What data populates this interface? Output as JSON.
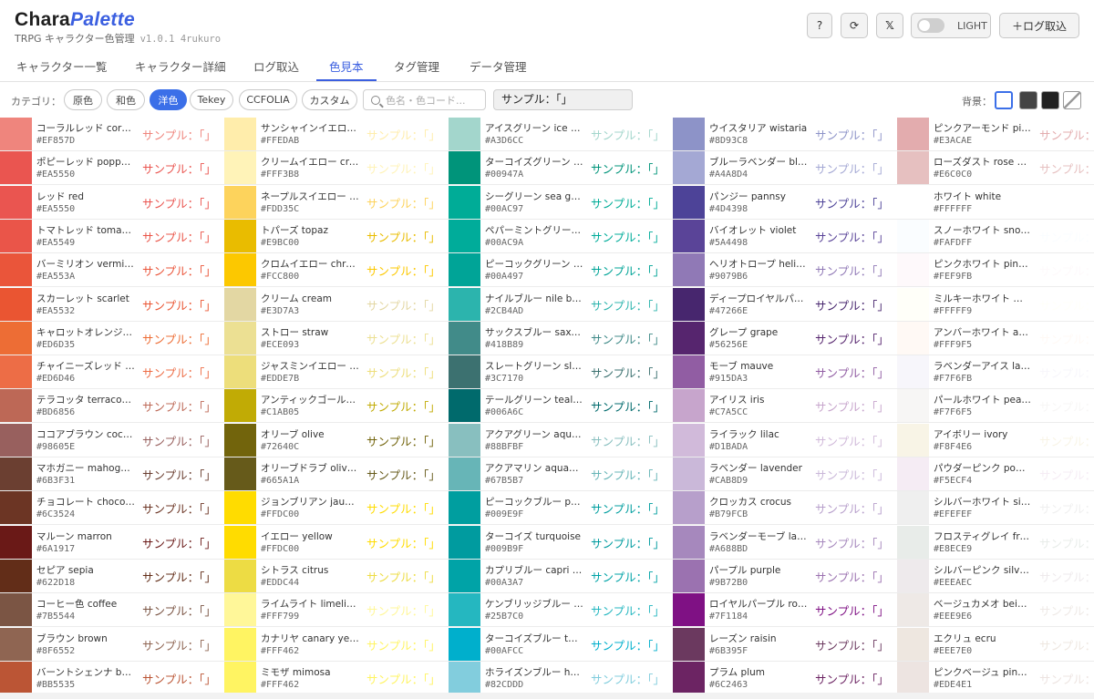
{
  "app": {
    "logo_part1": "Chara",
    "logo_part2": "Palette",
    "subtitle": "TRPG キャラクター色管理",
    "version": "v1.0.1 4rukuro"
  },
  "header_buttons": {
    "help": "?",
    "reload": "⟳",
    "x": "𝕏",
    "theme": "LIGHT",
    "log_import": "＋ログ取込"
  },
  "tabs": [
    "キャラクター一覧",
    "キャラクター詳細",
    "ログ取込",
    "色見本",
    "タグ管理",
    "データ管理"
  ],
  "active_tab": 3,
  "filters": {
    "category_label": "カテゴリ：",
    "chips": [
      "原色",
      "和色",
      "洋色",
      "Tekey",
      "CCFOLIA",
      "カスタム"
    ],
    "active_chip": 2,
    "search_placeholder": "色名・色コード...",
    "sample_value": "サンプル：「」",
    "bg_label": "背景："
  },
  "background_options": [
    {
      "name": "white",
      "color": "#FFFFFF"
    },
    {
      "name": "dark-gray",
      "color": "#444444"
    },
    {
      "name": "black",
      "color": "#222222"
    },
    {
      "name": "transparent",
      "color": "checker"
    }
  ],
  "sample_text": "サンプル：「」",
  "columns": [
    [
      {
        "name": "コーラルレッド coral…",
        "hex": "#EF857D"
      },
      {
        "name": "ポピーレッド poppy…",
        "hex": "#EA5550"
      },
      {
        "name": "レッド red",
        "hex": "#EA5550"
      },
      {
        "name": "トマトレッド tomato…",
        "hex": "#EA5549"
      },
      {
        "name": "バーミリオン vermilion",
        "hex": "#EA553A"
      },
      {
        "name": "スカーレット scarlet",
        "hex": "#EA5532"
      },
      {
        "name": "キャロットオレンジ c…",
        "hex": "#ED6D35"
      },
      {
        "name": "チャイニーズレッド c…",
        "hex": "#ED6D46"
      },
      {
        "name": "テラコッタ terracotta",
        "hex": "#BD6856"
      },
      {
        "name": "ココアブラウン coco…",
        "hex": "#98605E"
      },
      {
        "name": "マホガニー mahogany",
        "hex": "#6B3F31"
      },
      {
        "name": "チョコレート chocolate",
        "hex": "#6C3524"
      },
      {
        "name": "マルーン marron",
        "hex": "#6A1917"
      },
      {
        "name": "セピア sepia",
        "hex": "#622D18"
      },
      {
        "name": "コーヒー色 coffee",
        "hex": "#7B5544"
      },
      {
        "name": "ブラウン brown",
        "hex": "#8F6552"
      },
      {
        "name": "バーントシェンナ bur…",
        "hex": "#BB5535"
      }
    ],
    [
      {
        "name": "サンシャインイエロー…",
        "hex": "#FFEDAB"
      },
      {
        "name": "クリームイエロー cre…",
        "hex": "#FFF3B8"
      },
      {
        "name": "ネープルスイエロー n…",
        "hex": "#FDD35C"
      },
      {
        "name": "トパーズ topaz",
        "hex": "#E9BC00"
      },
      {
        "name": "クロムイエロー chro…",
        "hex": "#FCC800"
      },
      {
        "name": "クリーム cream",
        "hex": "#E3D7A3"
      },
      {
        "name": "ストロー straw",
        "hex": "#ECE093"
      },
      {
        "name": "ジャスミンイエロー j…",
        "hex": "#EDDE7B"
      },
      {
        "name": "アンティックゴール…",
        "hex": "#C1AB05"
      },
      {
        "name": "オリーブ olive",
        "hex": "#72640C"
      },
      {
        "name": "オリーブドラブ olive…",
        "hex": "#665A1A"
      },
      {
        "name": "ジョンブリアン jaune…",
        "hex": "#FFDC00"
      },
      {
        "name": "イエロー yellow",
        "hex": "#FFDC00"
      },
      {
        "name": "シトラス citrus",
        "hex": "#EDDC44"
      },
      {
        "name": "ライムライト limelight",
        "hex": "#FFF799"
      },
      {
        "name": "カナリヤ canary yellow",
        "hex": "#FFF462"
      },
      {
        "name": "ミモザ mimosa",
        "hex": "#FFF462"
      }
    ],
    [
      {
        "name": "アイスグリーン ice gr…",
        "hex": "#A3D6CC"
      },
      {
        "name": "ターコイズグリーン t…",
        "hex": "#00947A"
      },
      {
        "name": "シーグリーン sea green",
        "hex": "#00AC97"
      },
      {
        "name": "ペパーミントグリー…",
        "hex": "#00AC9A"
      },
      {
        "name": "ピーコックグリーン p…",
        "hex": "#00A497"
      },
      {
        "name": "ナイルブルー nile blue",
        "hex": "#2CB4AD"
      },
      {
        "name": "サックスブルー saxe…",
        "hex": "#418B89"
      },
      {
        "name": "スレートグリーン sla…",
        "hex": "#3C7170"
      },
      {
        "name": "テールグリーン teal g…",
        "hex": "#006A6C"
      },
      {
        "name": "アクアグリーン aqua…",
        "hex": "#88BFBF"
      },
      {
        "name": "アクアマリン aquam…",
        "hex": "#67B5B7"
      },
      {
        "name": "ピーコックブルー pe…",
        "hex": "#009E9F"
      },
      {
        "name": "ターコイズ turquoise",
        "hex": "#009B9F"
      },
      {
        "name": "カプリブルー capri bl…",
        "hex": "#00A3A7"
      },
      {
        "name": "ケンブリッジブルー c…",
        "hex": "#25B7C0"
      },
      {
        "name": "ターコイズブルー tur…",
        "hex": "#00AFCC"
      },
      {
        "name": "ホライズンブルー hor…",
        "hex": "#82CDDD"
      }
    ],
    [
      {
        "name": "ウイスタリア wistaria",
        "hex": "#8D93C8"
      },
      {
        "name": "ブルーラベンダー blu…",
        "hex": "#A4A8D4"
      },
      {
        "name": "パンジー pannsy",
        "hex": "#4D4398"
      },
      {
        "name": "バイオレット violet",
        "hex": "#5A4498"
      },
      {
        "name": "ヘリオトロープ helio…",
        "hex": "#9079B6"
      },
      {
        "name": "ディープロイヤルパー…",
        "hex": "#47266E"
      },
      {
        "name": "グレープ grape",
        "hex": "#56256E"
      },
      {
        "name": "モーブ mauve",
        "hex": "#915DA3"
      },
      {
        "name": "アイリス iris",
        "hex": "#C7A5CC"
      },
      {
        "name": "ライラック lilac",
        "hex": "#D1BADA"
      },
      {
        "name": "ラベンダー lavender",
        "hex": "#CAB8D9"
      },
      {
        "name": "クロッカス crocus",
        "hex": "#B79FCB"
      },
      {
        "name": "ラベンダーモーブ lav…",
        "hex": "#A688BD"
      },
      {
        "name": "パープル purple",
        "hex": "#9B72B0"
      },
      {
        "name": "ロイヤルパープル roy…",
        "hex": "#7F1184"
      },
      {
        "name": "レーズン raisin",
        "hex": "#6B395F"
      },
      {
        "name": "プラム plum",
        "hex": "#6C2463"
      }
    ],
    [
      {
        "name": "ピンクアーモンド pin…",
        "hex": "#E3ACAE"
      },
      {
        "name": "ローズダスト rose dust",
        "hex": "#E6C0C0"
      },
      {
        "name": "ホワイト white",
        "hex": "#FFFFFF"
      },
      {
        "name": "スノーホワイト snow…",
        "hex": "#FAFDFF"
      },
      {
        "name": "ピンクホワイト pink…",
        "hex": "#FEF9FB"
      },
      {
        "name": "ミルキーホワイト mil…",
        "hex": "#FFFFF9"
      },
      {
        "name": "アンバーホワイト am…",
        "hex": "#FFF9F5"
      },
      {
        "name": "ラベンダーアイス lav…",
        "hex": "#F7F6FB"
      },
      {
        "name": "パールホワイト pearl…",
        "hex": "#F7F6F5"
      },
      {
        "name": "アイボリー ivory",
        "hex": "#F8F4E6"
      },
      {
        "name": "パウダーピンク pow…",
        "hex": "#F5ECF4"
      },
      {
        "name": "シルバーホワイト silv…",
        "hex": "#EFEFEF"
      },
      {
        "name": "フロスティグレイ fro…",
        "hex": "#E8ECE9"
      },
      {
        "name": "シルバーピンク silver…",
        "hex": "#EEEAEC"
      },
      {
        "name": "ベージュカメオ beige…",
        "hex": "#EEE9E6"
      },
      {
        "name": "エクリュ ecru",
        "hex": "#EEE7E0"
      },
      {
        "name": "ピンクベージュ pink…",
        "hex": "#EDE4E1"
      }
    ]
  ]
}
